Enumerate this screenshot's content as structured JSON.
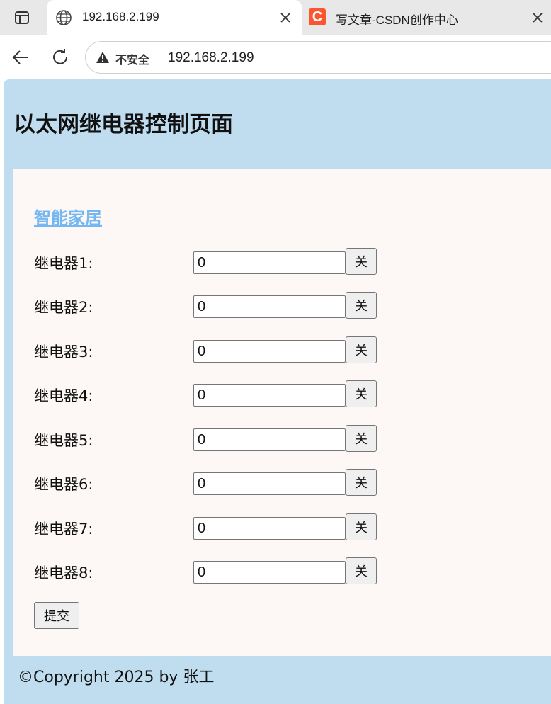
{
  "browser": {
    "tabs": [
      {
        "title": "192.168.2.199",
        "icon": "globe-icon",
        "active": true
      },
      {
        "title": "写文章-CSDN创作中心",
        "icon": "csdn-icon",
        "icon_letter": "C",
        "active": false
      }
    ],
    "address_bar": {
      "security_label": "不安全",
      "url": "192.168.2.199"
    }
  },
  "page": {
    "title": "以太网继电器控制页面",
    "section_link": "智能家居",
    "relays": [
      {
        "label": "继电器1:",
        "value": "0",
        "button": "关"
      },
      {
        "label": "继电器2:",
        "value": "0",
        "button": "关"
      },
      {
        "label": "继电器3:",
        "value": "0",
        "button": "关"
      },
      {
        "label": "继电器4:",
        "value": "0",
        "button": "关"
      },
      {
        "label": "继电器5:",
        "value": "0",
        "button": "关"
      },
      {
        "label": "继电器6:",
        "value": "0",
        "button": "关"
      },
      {
        "label": "继电器7:",
        "value": "0",
        "button": "关"
      },
      {
        "label": "继电器8:",
        "value": "0",
        "button": "关"
      }
    ],
    "submit_label": "提交",
    "footer": "©Copyright 2025 by 张工"
  },
  "colors": {
    "page_background": "#c0ddef",
    "card_background": "#fdf8f6",
    "link": "#74b7f2",
    "csdn_brand": "#fc5531"
  }
}
